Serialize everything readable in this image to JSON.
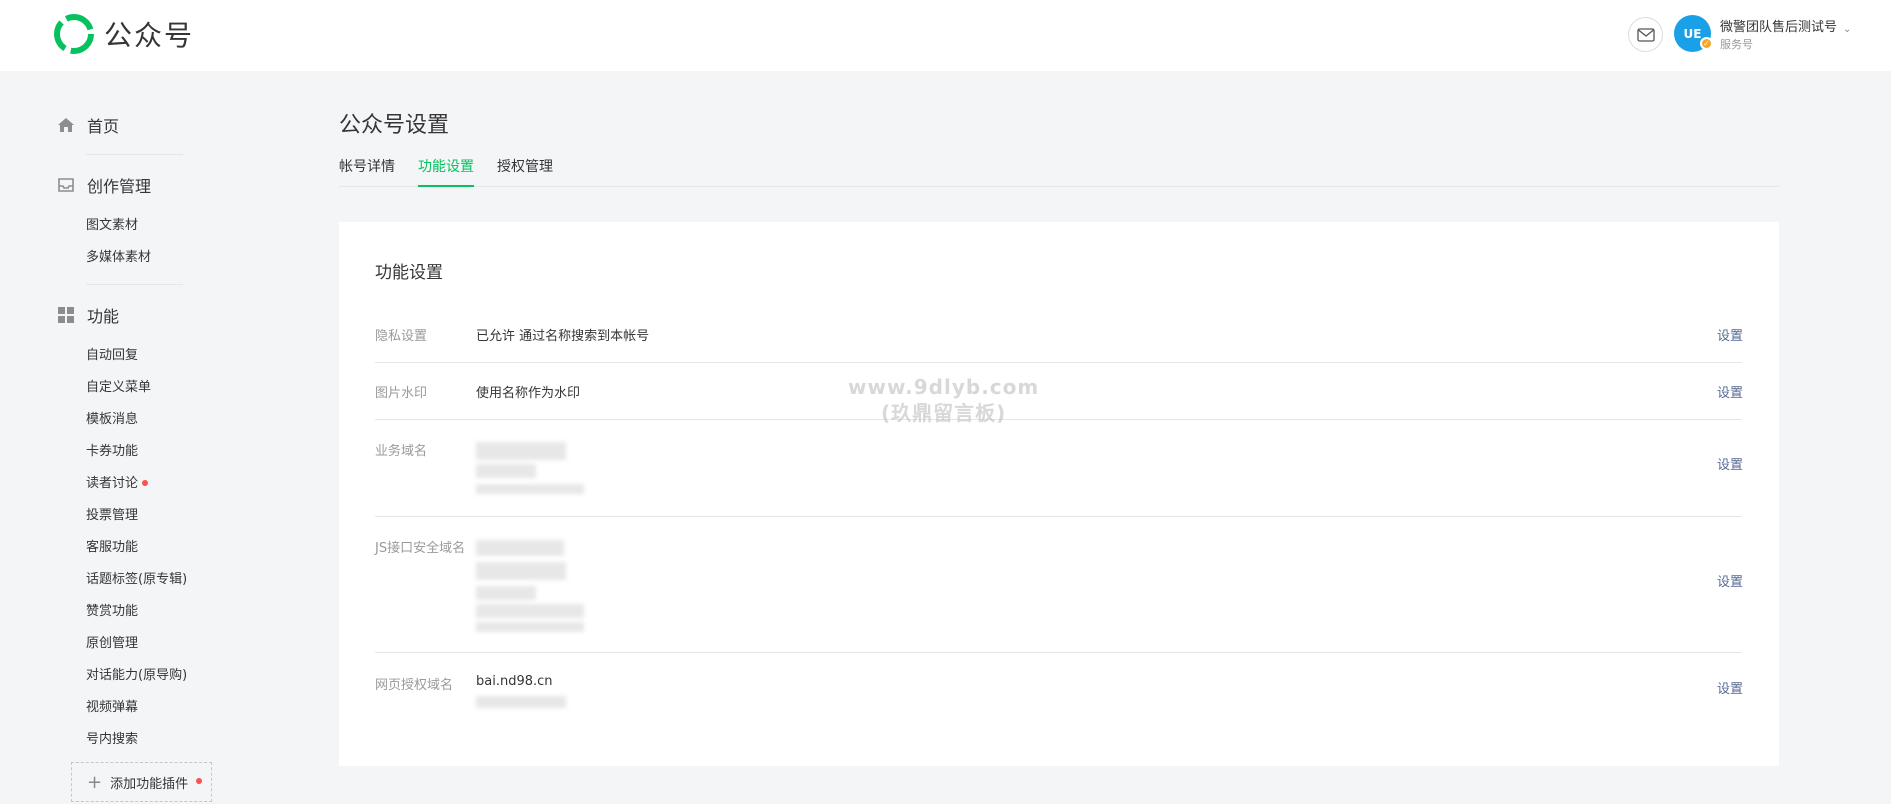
{
  "header": {
    "logo_text": "公众号",
    "account_name": "微警团队售后测试号",
    "account_type": "服务号",
    "avatar_text": "UE"
  },
  "sidebar": {
    "home": "首页",
    "creation": {
      "title": "创作管理",
      "items": [
        "图文素材",
        "多媒体素材"
      ]
    },
    "functions": {
      "title": "功能",
      "items": [
        "自动回复",
        "自定义菜单",
        "模板消息",
        "卡券功能",
        "读者讨论",
        "投票管理",
        "客服功能",
        "话题标签(原专辑)",
        "赞赏功能",
        "原创管理",
        "对话能力(原导购)",
        "视频弹幕",
        "号内搜索"
      ]
    },
    "add_plugin": "添加功能插件"
  },
  "main": {
    "page_title": "公众号设置",
    "tabs": [
      "帐号详情",
      "功能设置",
      "授权管理"
    ],
    "active_tab": "功能设置",
    "card_title": "功能设置",
    "rows": [
      {
        "label": "隐私设置",
        "value": "已允许 通过名称搜索到本帐号",
        "action": "设置"
      },
      {
        "label": "图片水印",
        "value": "使用名称作为水印",
        "action": "设置"
      },
      {
        "label": "业务域名",
        "value": "",
        "action": "设置"
      },
      {
        "label": "JS接口安全域名",
        "value": "",
        "action": "设置"
      },
      {
        "label": "网页授权域名",
        "value": "bai.nd98.cn",
        "action": "设置"
      }
    ]
  },
  "watermark": {
    "line1": "www.9dlyb.com",
    "line2": "(玖鼎留言板)"
  },
  "colors": {
    "brand_green": "#07c160",
    "link_blue": "#576b95",
    "red_dot": "#fa5151"
  }
}
